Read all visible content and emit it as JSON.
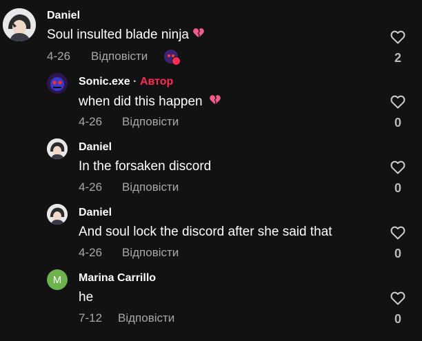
{
  "comments": [
    {
      "author": "Daniel",
      "text": "Soul insulted blade ninja",
      "text_emoji": "broken-heart",
      "date": "4-26",
      "reply_label": "Відповісти",
      "likes": "2",
      "liked_by_creator": true
    },
    {
      "author": "Sonic.exe",
      "separator": "·",
      "author_badge": "Автор",
      "text": "when did this happen",
      "text_emoji": "broken-heart",
      "date": "4-26",
      "reply_label": "Відповісти",
      "likes": "0"
    },
    {
      "author": "Daniel",
      "text": "In the forsaken discord",
      "date": "4-26",
      "reply_label": "Відповісти",
      "likes": "0"
    },
    {
      "author": "Daniel",
      "text": "And soul lock the discord after she said that",
      "date": "4-26",
      "reply_label": "Відповісти",
      "likes": "0"
    },
    {
      "author": "Marina Carrillo",
      "avatar_letter": "M",
      "text": "he",
      "date": "7-12",
      "reply_label": "Відповісти",
      "likes": "0"
    }
  ],
  "colors": {
    "background": "#121212",
    "author_badge": "#fe2c55",
    "muted_text": "#a8a8a8",
    "letter_avatar": "#6db24d"
  }
}
